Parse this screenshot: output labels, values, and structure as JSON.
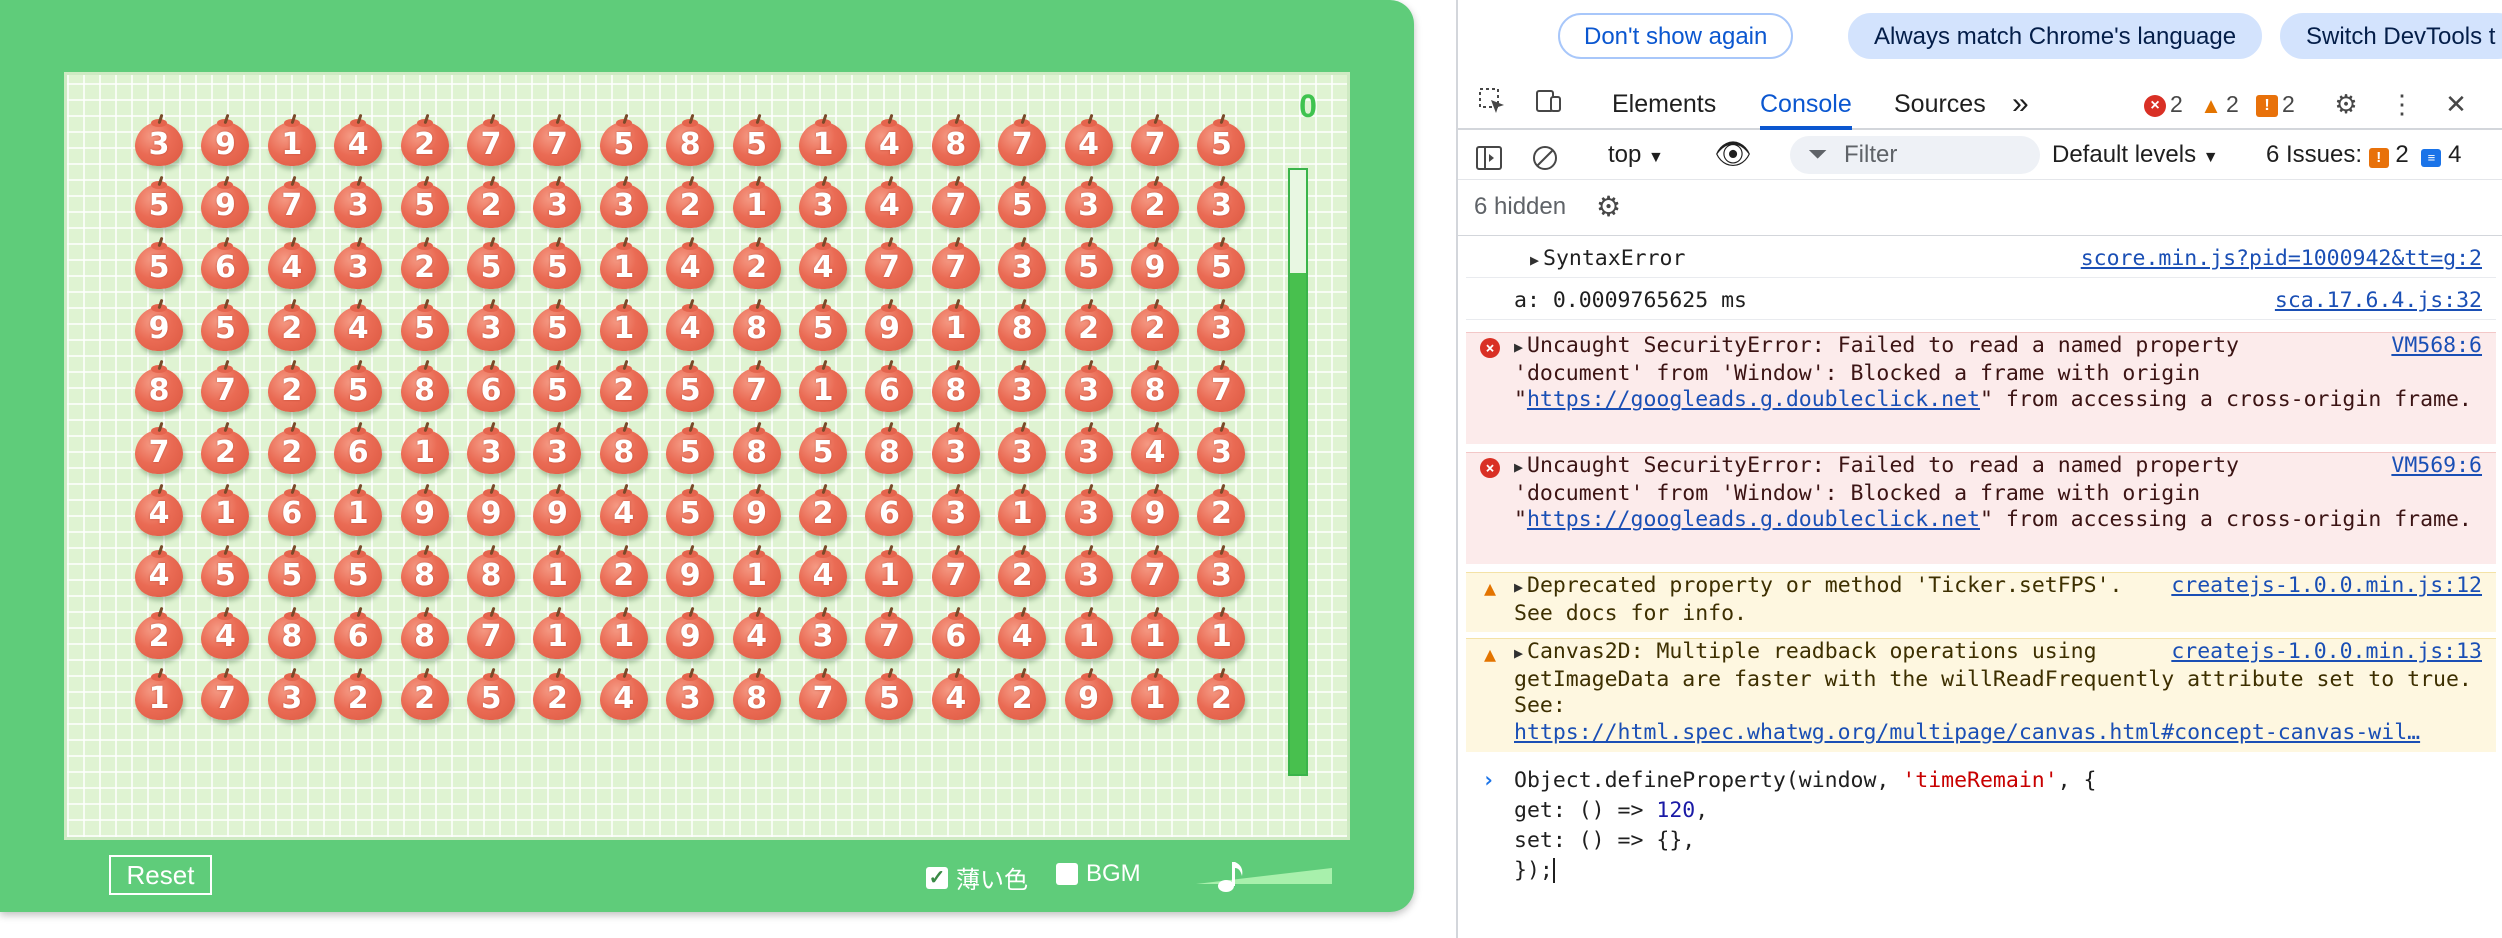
{
  "game": {
    "score": "0",
    "timer_fraction": 0.83,
    "reset_label": "Reset",
    "light_color_label": "薄い色",
    "light_color_checked": true,
    "bgm_label": "BGM",
    "bgm_checked": false,
    "volume_icon": "music-note-icon",
    "grid": [
      [
        3,
        9,
        1,
        4,
        2,
        7,
        7,
        5,
        8,
        5,
        1,
        4,
        8,
        7,
        4,
        7,
        5
      ],
      [
        5,
        9,
        7,
        3,
        5,
        2,
        3,
        3,
        2,
        1,
        3,
        4,
        7,
        5,
        3,
        2,
        3
      ],
      [
        5,
        6,
        4,
        3,
        2,
        5,
        5,
        1,
        4,
        2,
        4,
        7,
        7,
        3,
        5,
        9,
        5
      ],
      [
        9,
        5,
        2,
        4,
        5,
        3,
        5,
        1,
        4,
        8,
        5,
        9,
        1,
        8,
        2,
        2,
        3
      ],
      [
        8,
        7,
        2,
        5,
        8,
        6,
        5,
        2,
        5,
        7,
        1,
        6,
        8,
        3,
        3,
        8,
        7
      ],
      [
        7,
        2,
        2,
        6,
        1,
        3,
        3,
        8,
        5,
        8,
        5,
        8,
        3,
        3,
        3,
        4,
        3
      ],
      [
        4,
        1,
        6,
        1,
        9,
        9,
        9,
        4,
        5,
        9,
        2,
        6,
        3,
        1,
        3,
        9,
        2
      ],
      [
        4,
        5,
        5,
        5,
        8,
        8,
        1,
        2,
        9,
        1,
        4,
        1,
        7,
        2,
        3,
        7,
        3
      ],
      [
        2,
        4,
        8,
        6,
        8,
        7,
        1,
        1,
        9,
        4,
        3,
        7,
        6,
        4,
        1,
        1,
        1
      ],
      [
        1,
        7,
        3,
        2,
        2,
        5,
        2,
        4,
        3,
        8,
        7,
        5,
        4,
        2,
        9,
        1,
        2
      ]
    ]
  },
  "devtools": {
    "infobar": {
      "dont_show": "Don't show again",
      "match_language": "Always match Chrome's language",
      "switch": "Switch DevTools t"
    },
    "tabs": {
      "elements": "Elements",
      "console": "Console",
      "sources": "Sources",
      "more": "»"
    },
    "counts": {
      "errors": "2",
      "warnings": "2",
      "issues": "2"
    },
    "toolbar": {
      "context": "top",
      "filter_placeholder": "Filter",
      "levels": "Default levels",
      "issues_label": "6 Issues:",
      "issues_warn": "2",
      "issues_info": "4",
      "hidden": "6 hidden"
    },
    "messages": [
      {
        "type": "plain",
        "text": "SyntaxError",
        "source": "score.min.js?pid=1000942&tt=g:2"
      },
      {
        "type": "plain",
        "text": "a: 0.0009765625 ms",
        "source": "sca.17.6.4.js:32"
      },
      {
        "type": "error",
        "text1": "Uncaught SecurityError: Failed to read a named property 'document' from 'Window': Blocked a frame with origin \"",
        "link": "https://googleads.g.doubleclick.net",
        "text2": "\" from accessing a cross-origin frame.",
        "source": "VM568:6"
      },
      {
        "type": "error",
        "text1": "Uncaught SecurityError: Failed to read a named property 'document' from 'Window': Blocked a frame with origin \"",
        "link": "https://googleads.g.doubleclick.net",
        "text2": "\" from accessing a cross-origin frame.",
        "source": "VM569:6"
      },
      {
        "type": "warning",
        "text1": "Deprecated property or method 'Ticker.setFPS'. See docs for info.",
        "source": "createjs-1.0.0.min.js:12"
      },
      {
        "type": "warning",
        "text1": "Canvas2D: Multiple readback operations using getImageData are faster with the willReadFrequently attribute set to true. See: ",
        "link": "https://html.spec.whatwg.org/multipage/canvas.html#concept-canvas-wil…",
        "source": "createjs-1.0.0.min.js:13"
      }
    ],
    "input_lines": [
      "Object.defineProperty(window, 'timeRemain', {",
      "get: () => 120,",
      "set: () => {},",
      "});"
    ]
  }
}
